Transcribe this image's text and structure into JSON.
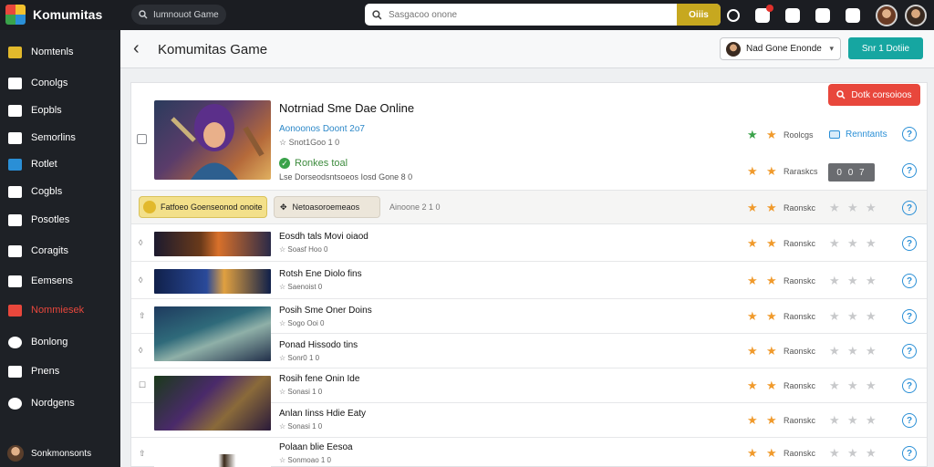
{
  "brand": {
    "title": "Komumitas"
  },
  "top_search": {
    "text": "Iumnouot Game"
  },
  "main_search": {
    "placeholder": "Sasgacoo onone",
    "button": "Oiiis"
  },
  "sidebar": {
    "items": [
      {
        "label": "Nomtenls"
      },
      {
        "label": "Conolgs"
      },
      {
        "label": "Eopbls"
      },
      {
        "label": "Semorlins"
      },
      {
        "label": "Rotlet"
      },
      {
        "label": "Cogbls"
      },
      {
        "label": "Posotles"
      },
      {
        "label": "Coragits"
      },
      {
        "label": "Eemsens"
      },
      {
        "label": "Nommiesek"
      },
      {
        "label": "Bonlong"
      },
      {
        "label": "Pnens"
      },
      {
        "label": "Nordgens"
      }
    ],
    "user": "Sonkmonsonts"
  },
  "header": {
    "title": "Komumitas Game",
    "game_select": "Nad Gone Enonde",
    "teal_button": "Snr 1 Dotiie"
  },
  "panel": {
    "red_button": "Dotk corsoioos",
    "featured": {
      "title": "Notrniad Sme Dae Online",
      "subtitle": "Aonoonos Doont 2o7",
      "meta": "Snot1Goo 1 0",
      "status": "Ronkes toal",
      "desc": "Lse Dorseodsntsoeos Iosd Gone 8 0",
      "rating_1": "Roolcgs",
      "link": "Renntants",
      "rating_2": "Raraskcs",
      "counter": "0 0 7"
    },
    "filters": {
      "chip_1": "Fatfoeo Goenseonod onoite",
      "chip_2": "Netoasoroemeaos",
      "label": "Ainoone 2 1 0"
    },
    "rating_label": "Raonskc",
    "rows": [
      {
        "title": "Eosdh tals Movi oiaod",
        "meta": "Soasf Hoo 0",
        "mark": "◊"
      },
      {
        "title": "Rotsh Ene Diolo fins",
        "meta": "Saenoist 0",
        "mark": "◊"
      },
      {
        "title": "Posih Sme Oner Doins",
        "meta": "Sogo Ooi 0",
        "mark": "⇧"
      },
      {
        "title": "Ponad Hissodo tins",
        "meta": "Sonr0 1 0",
        "mark": "◊"
      },
      {
        "title": "Rosih fene Onin Ide",
        "meta": "Sonasi 1 0",
        "mark": "☐"
      },
      {
        "title": "Anlan Iinss Hdie Eaty",
        "meta": "Sonasi 1 0",
        "mark": ""
      },
      {
        "title": "Polaan blie Eesoa",
        "meta": "Sonmoao 1 0",
        "mark": "⇧"
      }
    ]
  },
  "colors": {
    "accent_red": "#e8473c",
    "teal": "#16a6a1",
    "star": "#f09a2c",
    "link_blue": "#2a8fd6"
  }
}
